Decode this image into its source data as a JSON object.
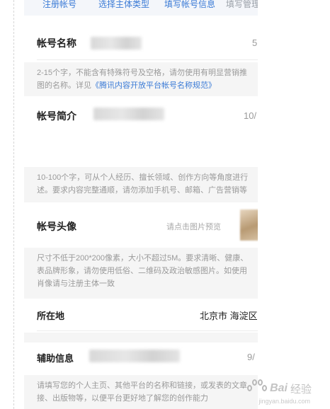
{
  "steps": [
    {
      "label": "注册帐号"
    },
    {
      "label": "选择主体类型"
    },
    {
      "label": "填写帐号信息"
    },
    {
      "label": "填写管理"
    }
  ],
  "account_name": {
    "label": "帐号名称",
    "counter": "5",
    "hint_line1": "2-15个字，不能含有特殊符号及空格，请勿使用有明显营销推",
    "hint_line2_prefix": "图的名称。详见",
    "hint_link": "《腾讯内容开放平台帐号名称规范》"
  },
  "account_intro": {
    "label": "帐号简介",
    "counter": "10/",
    "hint_line1": "10-100个字，可从个人经历、擅长领域、创作方向等角度进行",
    "hint_line2": "述。要求内容完整通顺，请勿添加手机号、邮箱、广告营销等"
  },
  "account_avatar": {
    "label": "帐号头像",
    "preview_hint": "请点击图片预览",
    "hint_line1": "尺寸不低于200*200像素，大小不超过5M。要求清晰、健康、",
    "hint_line2": "表品牌形象，请勿使用低俗、二维码及政治敏感图片。如使用",
    "hint_line3": "肖像请与注册主体一致"
  },
  "location": {
    "label": "所在地",
    "value": "北京市 海淀区"
  },
  "aux_info": {
    "label": "辅助信息",
    "counter": "9/",
    "hint_line1": "请填写您的个人主页、其他平台的名称和链接，或发表的文章",
    "hint_line2": "接、出版物等，以便平台更好地了解您的创作能力"
  },
  "watermark": {
    "brand": "Bai",
    "brand_cn": "经验",
    "url": "jingyan.baidu.com"
  },
  "colors": {
    "accent": "#3b7bd6",
    "hint_bg": "#f5f5f5",
    "hint_text": "#9a9a9a"
  }
}
